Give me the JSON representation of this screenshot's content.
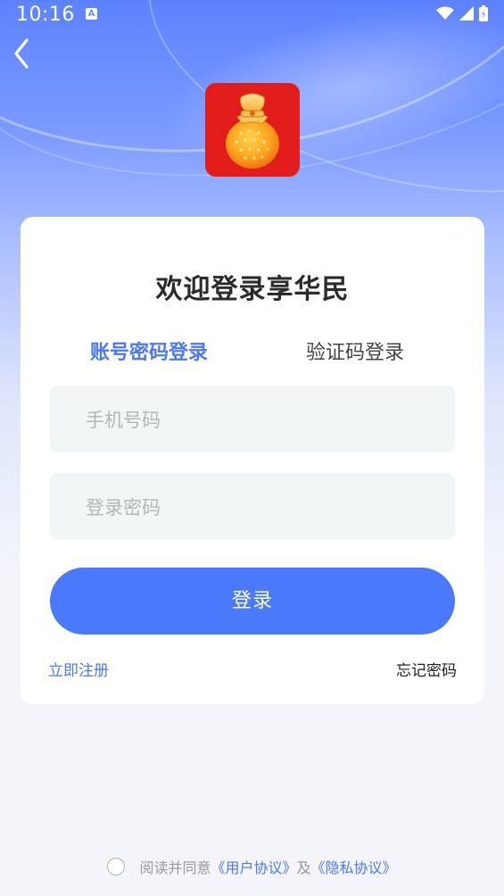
{
  "status_bar": {
    "time": "10:16",
    "notification_letter": "A"
  },
  "login_card": {
    "title": "欢迎登录享华民",
    "tabs": [
      {
        "label": "账号密码登录",
        "active": true
      },
      {
        "label": "验证码登录",
        "active": false
      }
    ],
    "phone_field": {
      "placeholder": "手机号码",
      "value": ""
    },
    "password_field": {
      "placeholder": "登录密码",
      "value": ""
    },
    "login_button": "登录",
    "register_link": "立即注册",
    "forgot_link": "忘记密码"
  },
  "agreement": {
    "prefix": "阅读并同意",
    "user_agreement": "《用户协议》",
    "and": "及",
    "privacy_policy": "《隐私协议》",
    "checked": false
  },
  "colors": {
    "accent": "#4a79fb",
    "link": "#4b78f4",
    "logo_bg": "#e21b1b",
    "field_bg": "#f1f6f6"
  },
  "icons": {
    "back": "chevron-left-icon",
    "logo": "lucky-bag-icon",
    "wifi": "wifi-icon",
    "signal": "signal-icon",
    "battery": "battery-icon"
  }
}
